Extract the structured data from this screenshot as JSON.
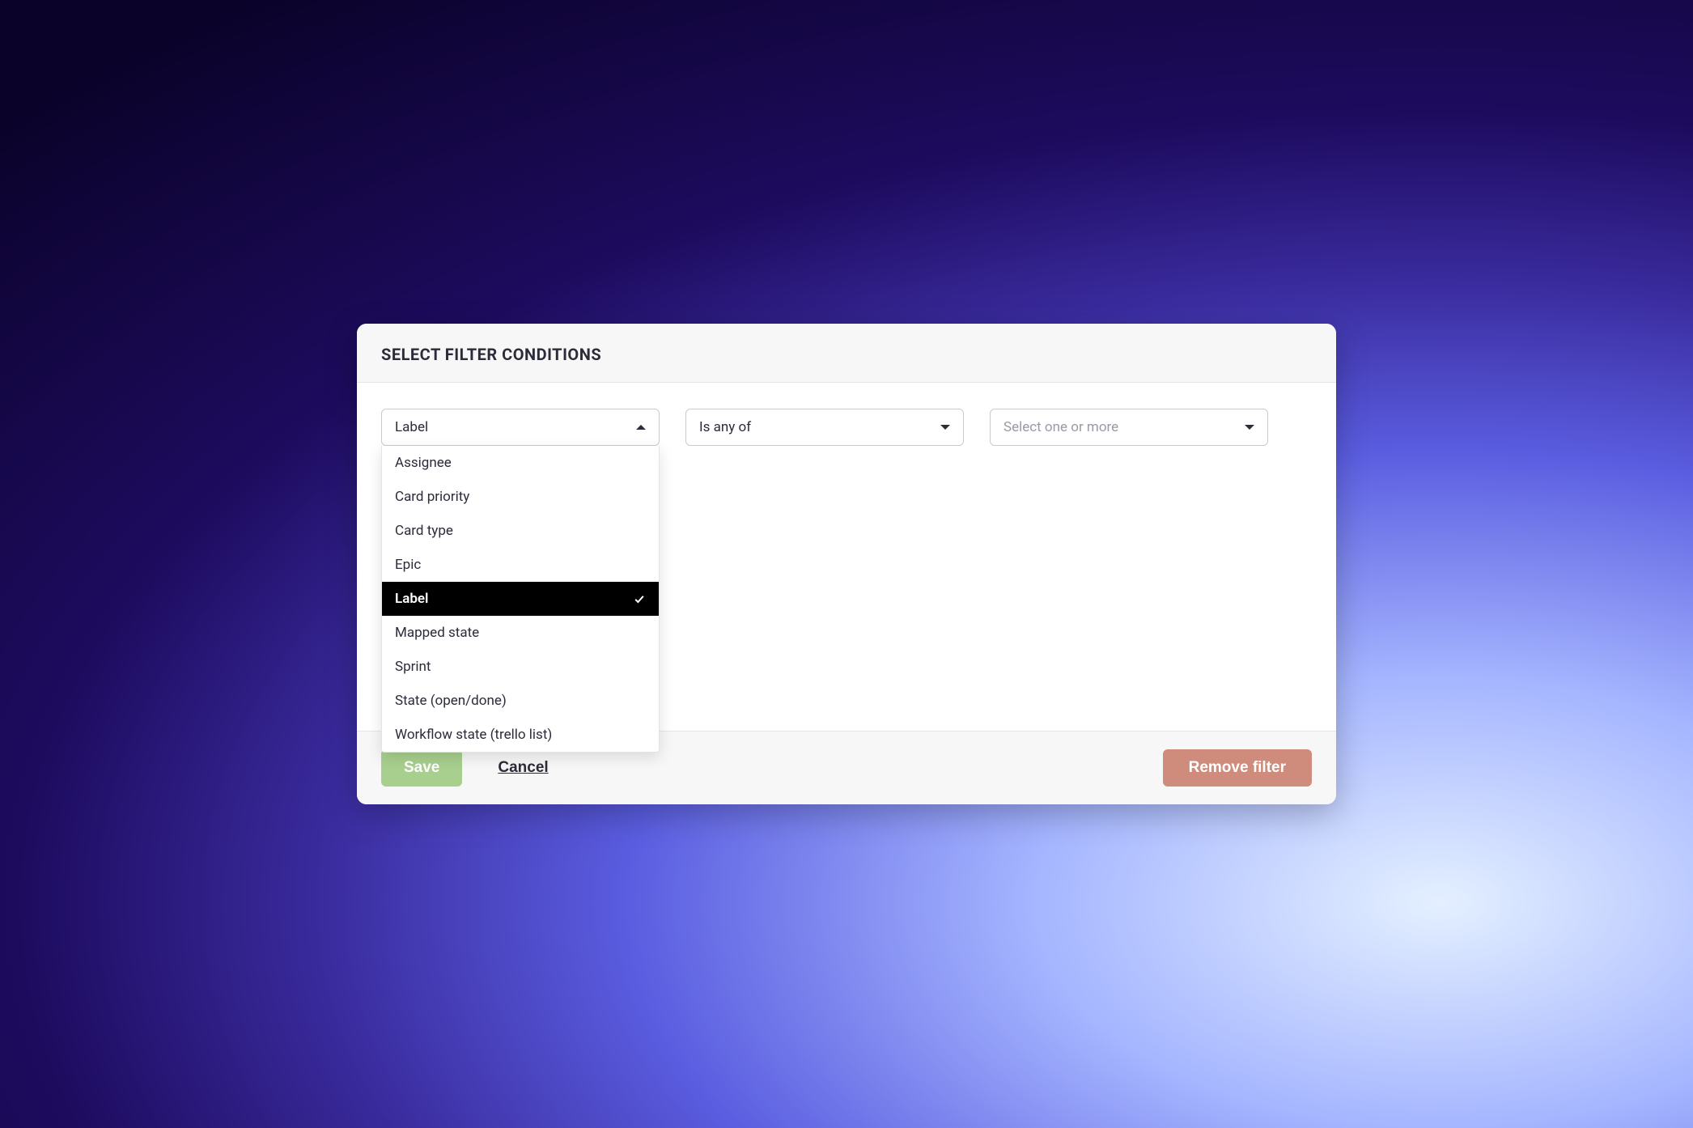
{
  "header": {
    "title": "SELECT FILTER CONDITIONS"
  },
  "field_select": {
    "selected": "Label",
    "options": [
      "Assignee",
      "Card priority",
      "Card type",
      "Epic",
      "Label",
      "Mapped state",
      "Sprint",
      "State (open/done)",
      "Workflow state (trello list)"
    ]
  },
  "operator_select": {
    "selected": "Is any of"
  },
  "value_select": {
    "placeholder": "Select one or more"
  },
  "footer": {
    "save_label": "Save",
    "cancel_label": "Cancel",
    "remove_label": "Remove filter"
  }
}
